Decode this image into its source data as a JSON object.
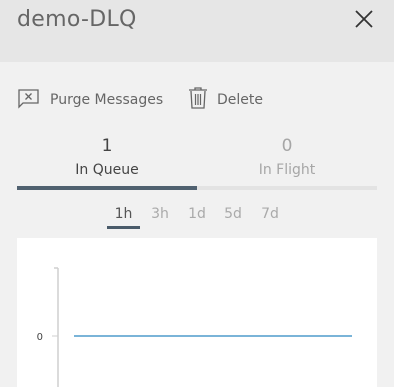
{
  "header": {
    "title": "demo-DLQ",
    "close_icon": "close-icon"
  },
  "toolbar": {
    "purge": {
      "label": "Purge Messages",
      "icon": "purge-icon"
    },
    "delete": {
      "label": "Delete",
      "icon": "trash-icon"
    }
  },
  "tabs": [
    {
      "count": "1",
      "label": "In Queue",
      "active": true
    },
    {
      "count": "0",
      "label": "In Flight",
      "active": false
    }
  ],
  "time_ranges": {
    "options": [
      "1h",
      "3h",
      "1d",
      "5d",
      "7d"
    ],
    "selected": "1h"
  },
  "colors": {
    "accent": "#506170",
    "series_line": "#2a87c0"
  },
  "chart_data": {
    "type": "line",
    "title": "",
    "xlabel": "",
    "ylabel": "",
    "y_ticks": [
      "0"
    ],
    "series": [
      {
        "values": [
          0,
          0
        ]
      }
    ],
    "grid": false
  }
}
